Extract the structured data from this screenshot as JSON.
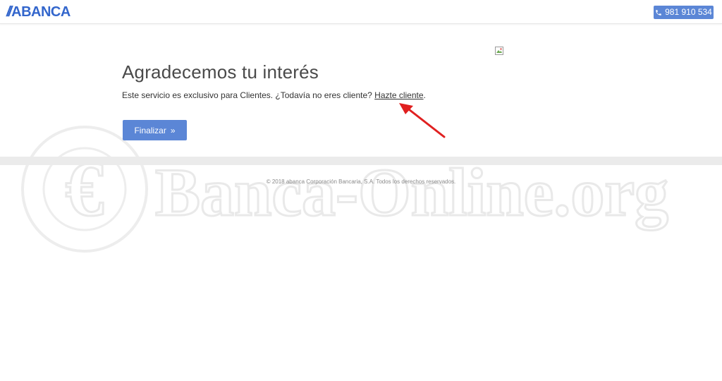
{
  "header": {
    "logo": {
      "slashes": "//",
      "text": "ABANCA",
      "color": "#3366cc"
    },
    "phone": {
      "icon": "phone-icon",
      "label": "981 910 534",
      "background": "#5b86d6"
    }
  },
  "main": {
    "title": "Agradecemos tu interés",
    "message_prefix": "Este servicio es exclusivo para Clientes. ¿Todavía no eres cliente? ",
    "link_label": "Hazte cliente",
    "message_suffix": ".",
    "finalizar": {
      "label": "Finalizar",
      "icon": "double-chevron-right-icon",
      "background": "#5b86d6"
    }
  },
  "annotation": {
    "icon": "red-arrow-icon",
    "color": "#e02020"
  },
  "footer": {
    "copyright": "© 2018 abanca Corporación Bancaria, S.A. Todos los derechos reservados."
  },
  "watermark": {
    "symbol": "€",
    "text": "Banca-Online.org"
  }
}
